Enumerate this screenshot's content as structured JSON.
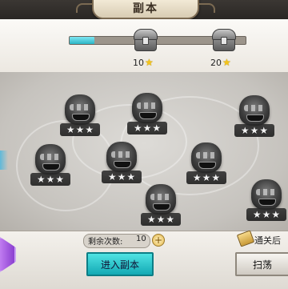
{
  "header": {
    "title": "副本"
  },
  "progress": {
    "fraction": 0.14
  },
  "rewards": [
    {
      "stars_required": "10",
      "star_icon": "gold-star-icon"
    },
    {
      "stars_required": "20",
      "star_icon": "gold-star-icon"
    }
  ],
  "stages": [
    {
      "stars": [
        "★",
        "★",
        "★"
      ]
    },
    {
      "stars": [
        "★",
        "★",
        "★"
      ]
    },
    {
      "stars": [
        "★",
        "★",
        "★"
      ]
    },
    {
      "stars": [
        "★",
        "★",
        "★"
      ]
    },
    {
      "stars": [
        "★",
        "★",
        "★"
      ]
    },
    {
      "stars": [
        "★",
        "★",
        "★"
      ]
    },
    {
      "stars": [
        "★",
        "★",
        "★"
      ]
    },
    {
      "stars": [
        "★",
        "★",
        "★"
      ]
    }
  ],
  "footer": {
    "remaining_label": "剩余次数:",
    "remaining_count": "10",
    "add_symbol": "+",
    "enter_label": "进入副本",
    "clear_label": "通关后",
    "sweep_label": "扫荡"
  },
  "colors": {
    "accent": "#2bb5c6",
    "star": "#f5c518"
  }
}
